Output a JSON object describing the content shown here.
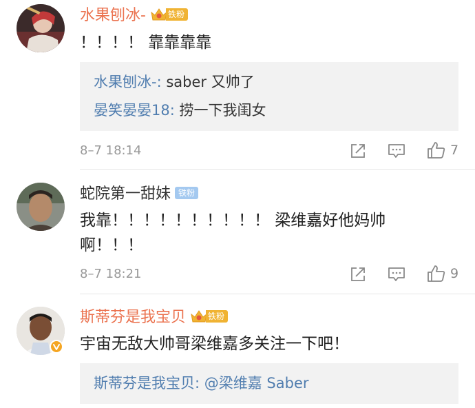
{
  "comments": [
    {
      "username": "水果刨冰-",
      "fan_label": "铁粉",
      "text": "！！！！ 靠靠靠靠",
      "replies": [
        {
          "who": "水果刨冰-",
          "sep": ":",
          "text": " saber 又帅了"
        },
        {
          "who": "晏笑晏晏18",
          "sep": ":",
          "text": " 捞一下我闺女"
        }
      ],
      "time": "8–7 18:14",
      "likes": "7"
    },
    {
      "username": "蛇院第一甜妹",
      "fan_label": "铁粉",
      "text_line1": "我靠！！！！！！！！！！ 梁维嘉好他妈帅",
      "text_line2": "啊！！！",
      "time": "8–7 18:21",
      "likes": "9"
    },
    {
      "username": "斯蒂芬是我宝贝",
      "fan_label": "铁粉",
      "text": "宇宙无敌大帅哥梁维嘉多关注一下吧！",
      "replies": [
        {
          "who": "斯蒂芬是我宝贝",
          "sep": ":",
          "text": " @梁维嘉 Saber"
        }
      ]
    }
  ],
  "colors": {
    "username_orange": "#eb7350",
    "reply_name_blue": "#507daf",
    "fan_gold": "#f0b333",
    "fan_blue": "#a4c9f0",
    "reply_bg": "#f2f2f2",
    "meta_gray": "#999999"
  },
  "icons": {
    "share": "share-icon",
    "comment": "comment-icon",
    "like": "thumbs-up-icon",
    "crown": "crown-icon",
    "verified": "verified-v-icon"
  }
}
